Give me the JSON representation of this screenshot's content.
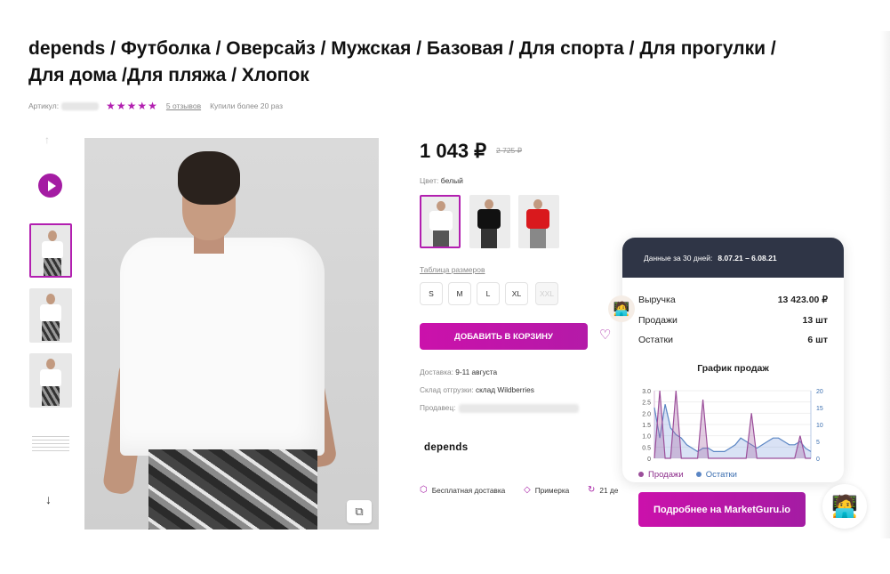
{
  "product": {
    "title": "depends / Футболка / Оверсайз / Мужская / Базовая / Для спорта / Для прогулки / Для дома /Для пляжа / Хлопок",
    "article_label": "Артикул:",
    "rating_stars": 5,
    "reviews_link": "5 отзывов",
    "bought_text": "Купили более 20 раз",
    "price": "1 043 ₽",
    "old_price": "2 725 ₽",
    "color_label": "Цвет:",
    "color_value": "белый",
    "size_table_link": "Таблица размеров",
    "sizes": [
      "S",
      "M",
      "L",
      "XL",
      "XXL"
    ],
    "disabled_size": "XXL",
    "add_to_cart": "ДОБАВИТЬ В КОРЗИНУ",
    "delivery_label": "Доставка:",
    "delivery_value": "9-11 августа",
    "warehouse_label": "Склад отгрузки:",
    "warehouse_value": "склад Wildberries",
    "seller_label": "Продавец:",
    "brand_logo": "depends",
    "features": [
      "Бесплатная доставка",
      "Примерка",
      "21 де"
    ],
    "swatch_colors": [
      "#ffffff",
      "#111111",
      "#d9191d"
    ]
  },
  "marketguru": {
    "header_label": "Данные за 30 дней:",
    "header_period": "8.07.21 – 6.08.21",
    "rows": [
      {
        "label": "Выручка",
        "value": "13 423.00 ₽"
      },
      {
        "label": "Продажи",
        "value": "13 шт"
      },
      {
        "label": "Остатки",
        "value": "6 шт"
      }
    ],
    "chart_title": "График продаж",
    "legend_sales": "Продажи",
    "legend_stock": "Остатки",
    "button_label": "Подробнее на MarketGuru.io",
    "colors": {
      "sales": "#9b4e9a",
      "stock": "#5b86c4",
      "accent": "#cb11ab"
    }
  },
  "chart_data": {
    "type": "area",
    "title": "График продаж",
    "x": [
      1,
      2,
      3,
      4,
      5,
      6,
      7,
      8,
      9,
      10,
      11,
      12,
      13,
      14,
      15,
      16,
      17,
      18,
      19,
      20,
      21,
      22,
      23,
      24,
      25,
      26,
      27,
      28,
      29,
      30
    ],
    "left_ticks": [
      "3.0",
      "2.5",
      "2.0",
      "1.5",
      "1.0",
      "0.5",
      "0"
    ],
    "right_ticks": [
      "20",
      "15",
      "10",
      "5",
      "0"
    ],
    "ylim_left": [
      0,
      3
    ],
    "ylim_right": [
      0,
      20
    ],
    "series": [
      {
        "name": "Продажи",
        "axis": "left",
        "values": [
          0,
          3,
          0,
          0,
          3,
          0,
          0,
          0,
          0,
          2.6,
          0,
          0,
          0,
          0,
          0,
          0,
          0,
          0,
          2,
          0,
          0,
          0,
          0,
          0,
          0,
          0,
          0,
          1,
          0,
          0
        ]
      },
      {
        "name": "Остатки",
        "axis": "right",
        "values": [
          15,
          6,
          16,
          9,
          7,
          6,
          4,
          3,
          2,
          3,
          3,
          2,
          2,
          2,
          3,
          4,
          6,
          5,
          4,
          3,
          4,
          5,
          6,
          6,
          5,
          4,
          4,
          5,
          3,
          2
        ]
      }
    ]
  }
}
